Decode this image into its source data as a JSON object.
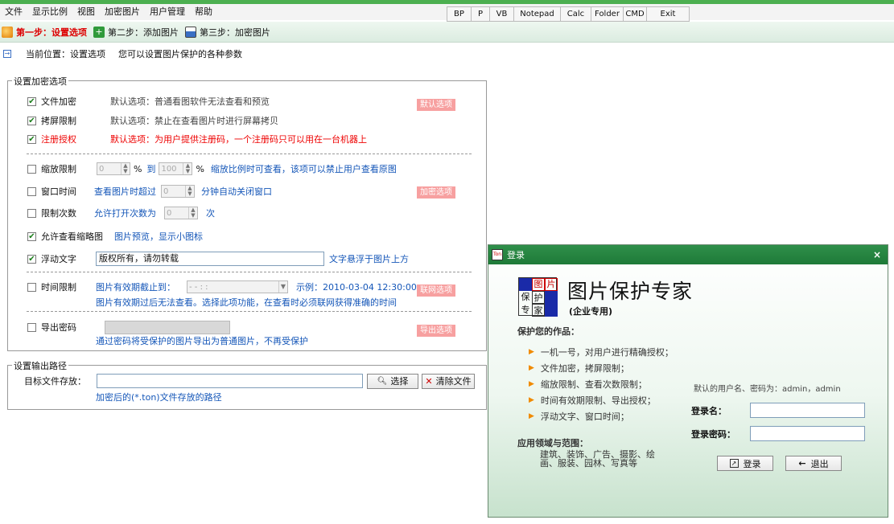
{
  "menu": [
    "文件",
    "显示比例",
    "视图",
    "加密图片",
    "用户管理",
    "帮助"
  ],
  "tools": [
    "BP",
    "P",
    "VB",
    "Notepad",
    "Calc",
    "Folder",
    "CMD",
    "Exit"
  ],
  "steps": [
    "第一步：设置选项",
    "第二步：添加图片",
    "第三步：加密图片"
  ],
  "path": {
    "label": "当前位置：设置选项",
    "hint": "您可以设置图片保护的各种参数"
  },
  "encrypt_group": {
    "title": "设置加密选项",
    "file_encrypt": {
      "label": "文件加密",
      "desc": "默认选项：普通看图软件无法查看和预览",
      "checked": true
    },
    "screen_limit": {
      "label": "拷屏限制",
      "desc": "默认选项：禁止在查看图片时进行屏幕拷贝",
      "checked": true
    },
    "register": {
      "label": "注册授权",
      "desc": "默认选项：为用户提供注册码，一个注册码只可以用在一台机器上",
      "checked": true
    },
    "default_badge": "默认选项",
    "zoom": {
      "label": "缩放限制",
      "from": "0",
      "pct": "%",
      "to_label": "到",
      "to": "100",
      "desc": "缩放比例时可查看，该项可以禁止用户查看原图",
      "checked": false
    },
    "window_time": {
      "label": "窗口时间",
      "pre": "查看图片时超过",
      "value": "0",
      "post": "分钟自动关闭窗口",
      "checked": false
    },
    "encrypt_badge": "加密选项",
    "open_count": {
      "label": "限制次数",
      "pre": "允许打开次数为",
      "value": "0",
      "post": "次",
      "checked": false
    },
    "thumb": {
      "label": "允许查看缩略图",
      "desc": "图片预览，显示小图标",
      "checked": true
    },
    "float_text": {
      "label": "浮动文字",
      "value": "版权所有，请勿转载",
      "desc": "文字悬浮于图片上方",
      "checked": true
    },
    "time_limit": {
      "label": "时间限制",
      "pre": "图片有效期截止到：",
      "date": "-   -       :   :",
      "example": "示例：2010-03-04 12:30:00",
      "note": "图片有效期过后无法查看。选择此项功能，在查看时必须联网获得准确的时间",
      "checked": false
    },
    "network_badge": "联网选项",
    "export_pwd": {
      "label": "导出密码",
      "note": "通过密码将受保护的图片导出为普通图片，不再受保护",
      "checked": false
    },
    "export_badge": "导出选项"
  },
  "output_group": {
    "title": "设置输出路径",
    "target_label": "目标文件存放：",
    "target_value": "",
    "choose_btn": "选择",
    "clear_btn": "清除文件",
    "note": "加密后的(*.ton)文件存放的路径"
  },
  "login": {
    "title": "登录",
    "logo": [
      "图",
      "片",
      "保",
      "护",
      "专",
      "家"
    ],
    "app_name": "图片保护专家",
    "edition": "(企业专用)",
    "protect_heading": "保护您的作品：",
    "features": [
      "一机一号，对用户进行精确授权；",
      "文件加密，拷屏限制；",
      "缩放限制、查看次数限制；",
      "时间有效期限制、导出授权；",
      "浮动文字、窗口时间；"
    ],
    "domain_heading": "应用领域与范围：",
    "domain_text": [
      "建筑、装饰、广告、摄影、绘",
      "画、服装、园林、写真等"
    ],
    "default_hint": "默认的用户名、密码为：admin，admin",
    "user_label": "登录名：",
    "pwd_label": "登录密码：",
    "login_btn": "登录",
    "exit_btn": "退出"
  },
  "colors": {
    "accent": "#4caf50",
    "badge": "#f7a0a0",
    "blue_text": "#1456b8",
    "red_text": "#e00000"
  }
}
